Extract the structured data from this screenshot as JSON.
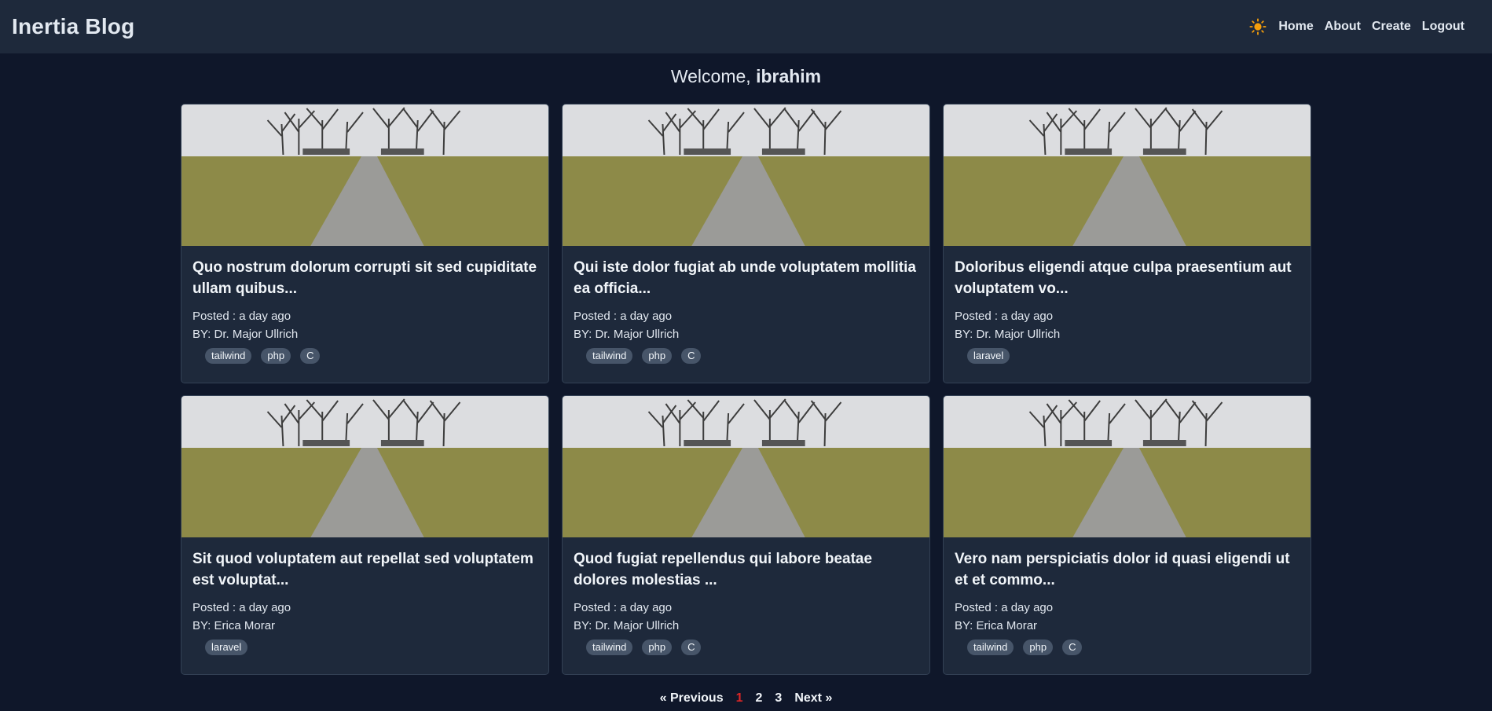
{
  "navbar": {
    "brand": "Inertia Blog",
    "links": [
      "Home",
      "About",
      "Create",
      "Logout"
    ]
  },
  "welcome": {
    "prefix": "Welcome, ",
    "user": "ibrahim"
  },
  "posts": [
    {
      "title": "Quo nostrum dolorum corrupti sit sed cupiditate ullam quibus...",
      "posted": "Posted : a day ago",
      "author": "BY: Dr. Major Ullrich",
      "tags": [
        "tailwind",
        "php",
        "C"
      ]
    },
    {
      "title": "Qui iste dolor fugiat ab unde voluptatem mollitia ea officia...",
      "posted": "Posted : a day ago",
      "author": "BY: Dr. Major Ullrich",
      "tags": [
        "tailwind",
        "php",
        "C"
      ]
    },
    {
      "title": "Doloribus eligendi atque culpa praesentium aut voluptatem vo...",
      "posted": "Posted : a day ago",
      "author": "BY: Dr. Major Ullrich",
      "tags": [
        "laravel"
      ]
    },
    {
      "title": "Sit quod voluptatem aut repellat sed voluptatem est voluptat...",
      "posted": "Posted : a day ago",
      "author": "BY: Erica Morar",
      "tags": [
        "laravel"
      ]
    },
    {
      "title": "Quod fugiat repellendus qui labore beatae dolores molestias ...",
      "posted": "Posted : a day ago",
      "author": "BY: Dr. Major Ullrich",
      "tags": [
        "tailwind",
        "php",
        "C"
      ]
    },
    {
      "title": "Vero nam perspiciatis dolor id quasi eligendi ut et et commo...",
      "posted": "Posted : a day ago",
      "author": "BY: Erica Morar",
      "tags": [
        "tailwind",
        "php",
        "C"
      ]
    }
  ],
  "pagination": {
    "previous": "« Previous",
    "pages": [
      "1",
      "2",
      "3"
    ],
    "current": "1",
    "next": "Next »"
  },
  "colors": {
    "background": "#0f172a",
    "surface": "#1e293b",
    "tag": "#475569",
    "active_page": "#dc2626",
    "sun": "#f59e0b"
  },
  "icons": {
    "theme_toggle": "sun-icon"
  }
}
